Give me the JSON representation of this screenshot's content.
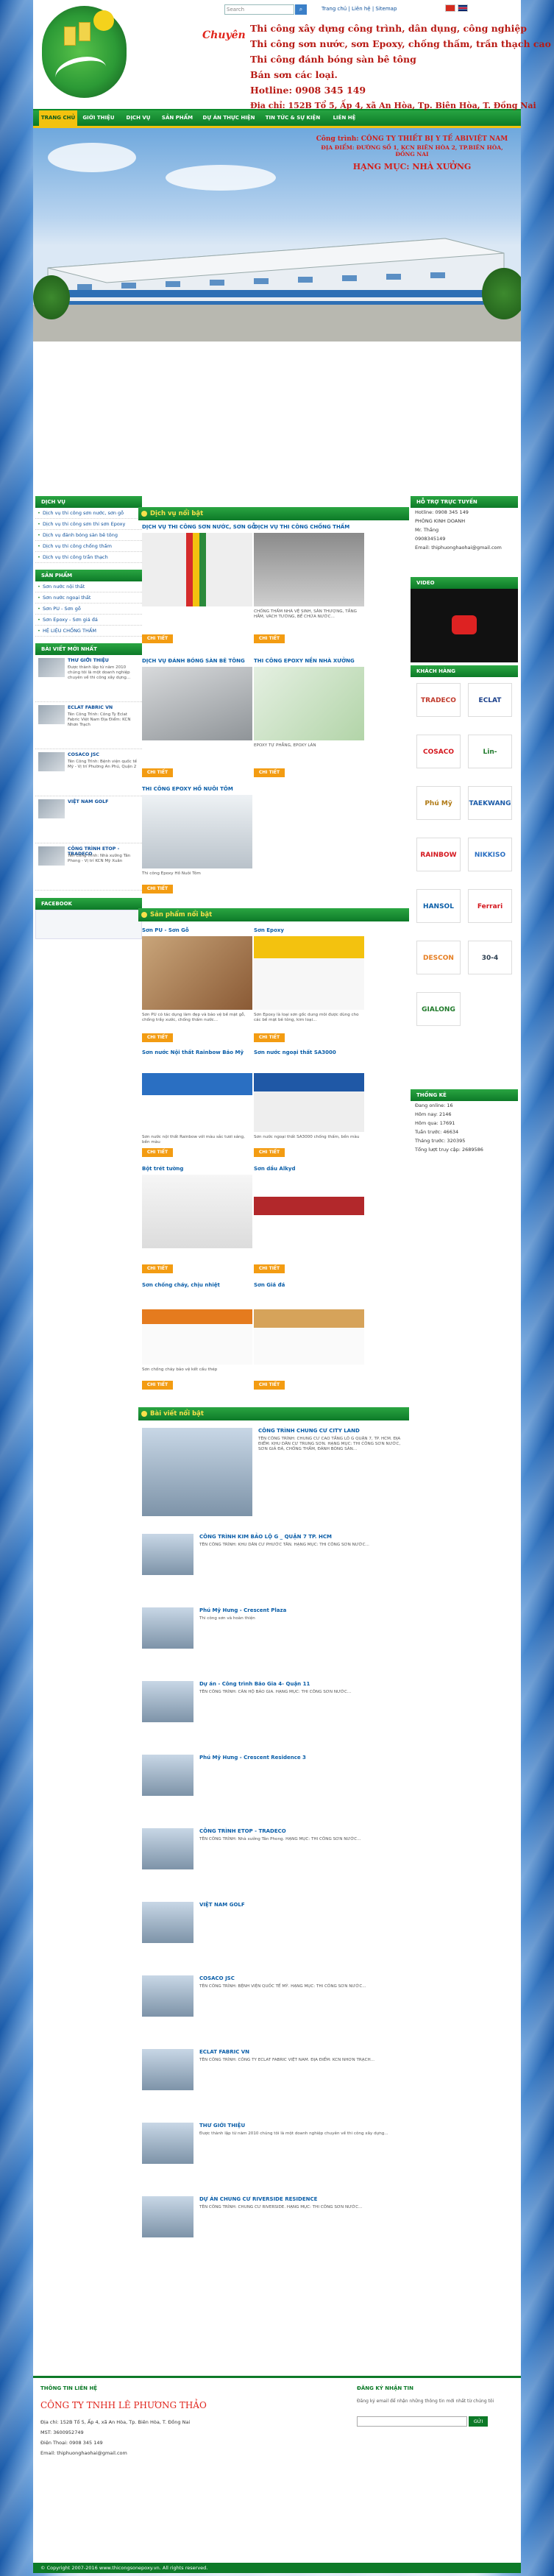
{
  "header": {
    "logo_script": "Chuyên",
    "search_placeholder": "Search",
    "toplinks": "Trang chủ | Liên hệ | Sitemap",
    "lines": [
      "Thi công xây dựng công trình, dân dụng, công nghiệp",
      "Thi công sơn nước, sơn Epoxy, chống thấm, trần thạch cao",
      "Thi công đánh bóng sàn bê tông",
      "Bán sơn các loại.",
      "Hotline: 0908 345 149",
      "Địa chỉ: 152B Tổ 5, Ấp 4, xã An Hòa, Tp. Biên Hòa, T. Đồng Nai"
    ]
  },
  "nav": [
    "TRANG CHỦ",
    "GIỚI THIỆU",
    "DỊCH VỤ",
    "SẢN PHẨM",
    "DỰ ÁN THỰC HIỆN",
    "TIN TỨC & SỰ KIỆN",
    "LIÊN HỆ"
  ],
  "banner": {
    "t1": "Công trình: CÔNG TY THIẾT BỊ Y TẾ ABIVIỆT NAM",
    "t2": "ĐỊA ĐIỂM: ĐƯỜNG SỐ 1, KCN BIÊN HÒA 2, TP.BIÊN HÒA, ĐỒNG NAI",
    "t3": "HẠNG MỤC: NHÀ XƯỞNG"
  },
  "left": {
    "dichvu_head": "DỊCH VỤ",
    "dichvu": [
      "Dịch vụ thi công sơn nước, sơn gỗ",
      "Dịch vụ thi công sơn thi sơn Epoxy",
      "Dịch vụ đánh bóng sàn bê tông",
      "Dịch vụ thi công chống thấm",
      "Dịch vụ thi công trần thạch"
    ],
    "sanpham_head": "SẢN PHẨM",
    "sanpham": [
      "Sơn nước nội thất",
      "Sơn nước ngoại thất",
      "Sơn PU - Sơn gỗ",
      "Sơn Epoxy - Sơn giả đá",
      "HỆ LIỆU CHỐNG THẤM"
    ],
    "news_head": "BÀI VIẾT MỚI NHẤT",
    "news": [
      {
        "title": "THƯ GIỚI THIỆU",
        "desc": "Được thành lập từ năm 2010 chúng tôi là một doanh nghiệp chuyên về thi công xây dựng..."
      },
      {
        "title": "ECLAT FABRIC VN",
        "desc": "Tên Công Trình: Công Ty Eclat Fabric Việt Nam Địa Điểm: KCN Nhơn Trạch"
      },
      {
        "title": "COSACO JSC",
        "desc": "Tên Công Trình: Bệnh viện quốc tế Mỹ - Vị trí Phường An Phú, Quận 2"
      },
      {
        "title": "VIỆT NAM GOLF",
        "desc": ""
      },
      {
        "title": "CÔNG TRÌNH ETOP - TRADECO",
        "desc": "Tên Công Trình: Nhà xưởng Tân Phong - Vị trí KCN Mỹ Xuân"
      }
    ],
    "facebook_head": "FACEBOOK"
  },
  "right": {
    "support_head": "HỖ TRỢ TRỰC TUYẾN",
    "support": [
      "Hotline: 0908 345 149",
      "PHÒNG KINH DOANH",
      "Mr. Thắng",
      "0908345149",
      "Email: thiphuonghaohai@gmail.com"
    ],
    "video_head": "VIDEO",
    "partners_head": "KHÁCH HÀNG",
    "partners": [
      "TRADECO",
      "ECLAT",
      "COSACO",
      "Lin-Precision",
      "Phú Mỹ Hưng",
      "TAEKWANG",
      "RAINBOW",
      "NIKKISO",
      "HANSOL",
      "Ferrari",
      "DESCON",
      "30-4",
      "GIALONG"
    ],
    "stats_head": "THỐNG KÊ",
    "stats": [
      "Đang online: 16",
      "Hôm nay: 2146",
      "Hôm qua: 17691",
      "Tuần trước: 46634",
      "Tháng trước: 320395",
      "Tổng lượt truy cập: 2689586"
    ]
  },
  "services": {
    "head": "Dịch vụ nổi bật",
    "items": [
      {
        "title": "DỊCH VỤ THI CÔNG SƠN NƯỚC, SƠN GỖ",
        "desc": ""
      },
      {
        "title": "DỊCH VỤ THI CÔNG CHỐNG THẤM",
        "desc": "CHỐNG THẤM NHÀ VỆ SINH, SÂN THƯỢNG, TẦNG HẦM, VÁCH TƯỜNG, BỂ CHỨA NƯỚC..."
      },
      {
        "title": "DỊCH VỤ ĐÁNH BÓNG SÀN BÊ TÔNG",
        "desc": ""
      },
      {
        "title": "THI CÔNG EPOXY NỀN NHÀ XƯỞNG",
        "desc": "EPOXY TỰ PHẲNG, EPOXY LĂN"
      },
      {
        "title": "THI CÔNG EPOXY HỒ NUÔI TÔM",
        "desc": "Thi công Epoxy Hồ Nuôi Tôm"
      }
    ],
    "more": "CHI TIẾT"
  },
  "products": {
    "head": "Sản phẩm nổi bật",
    "items": [
      {
        "title": "Sơn PU - Sơn Gỗ",
        "desc": "Sơn PU có tác dụng làm đẹp và bảo vệ bề mặt gỗ, chống trầy xước, chống thấm nước..."
      },
      {
        "title": "Sơn Epoxy",
        "desc": "Sơn Epoxy là loại sơn gốc dung môi được dùng cho các bề mặt bê tông, kim loại..."
      },
      {
        "title": "Sơn nước Nội thất Rainbow Bảo Mỹ",
        "desc": "Sơn nước nội thất Rainbow với màu sắc tươi sáng, bền màu"
      },
      {
        "title": "Sơn nước ngoại thất SA3000",
        "desc": "Sơn nước ngoại thất SA3000 chống thấm, bền màu"
      },
      {
        "title": "Bột trét tường",
        "desc": ""
      },
      {
        "title": "Sơn dầu Alkyd",
        "desc": ""
      },
      {
        "title": "Sơn chống cháy, chịu nhiệt",
        "desc": "Sơn chống cháy bảo vệ kết cấu thép"
      },
      {
        "title": "Sơn Giả đá",
        "desc": ""
      }
    ],
    "more": "CHI TIẾT"
  },
  "articles": {
    "head": "Bài viết nổi bật",
    "top": {
      "title": "CÔNG TRÌNH CHUNG CƯ CITY LAND",
      "desc": "TÊN CÔNG TRÌNH: CHUNG CƯ CAO TẦNG LÔ G QUẬN 7, TP. HCM. ĐỊA ĐIỂM: KHU DÂN CƯ TRUNG SƠN. HẠNG MỤC: THI CÔNG SƠN NƯỚC, SƠN GIẢ ĐÁ, CHỐNG THẤM, ĐÁNH BÓNG SÀN..."
    },
    "items": [
      {
        "title": "CÔNG TRÌNH KIM BẢO LỘ G _ QUẬN 7 TP. HCM",
        "desc": "TÊN CÔNG TRÌNH: KHU DÂN CƯ PHƯỚC TÂN. HẠNG MỤC: THI CÔNG SƠN NƯỚC..."
      },
      {
        "title": "Phú Mỹ Hưng - Crescent Plaza",
        "desc": "Thi công sơn và hoàn thiện"
      },
      {
        "title": "Dự án - Công trình Bảo Gia 4- Quận 11",
        "desc": "TÊN CÔNG TRÌNH: CĂN HỘ BẢO GIA. HẠNG MỤC: THI CÔNG SƠN NƯỚC..."
      },
      {
        "title": "Phú Mỹ Hưng - Crescent Residence 3",
        "desc": ""
      },
      {
        "title": "CÔNG TRÌNH ETOP - TRADECO",
        "desc": "TÊN CÔNG TRÌNH: Nhà xưởng Tân Phong. HẠNG MỤC: THI CÔNG SƠN NƯỚC..."
      },
      {
        "title": "VIỆT NAM GOLF",
        "desc": ""
      },
      {
        "title": "COSACO JSC",
        "desc": "TÊN CÔNG TRÌNH: BỆNH VIỆN QUỐC TẾ MỸ. HẠNG MỤC: THI CÔNG SƠN NƯỚC..."
      },
      {
        "title": "ECLAT FABRIC VN",
        "desc": "TÊN CÔNG TRÌNH: CÔNG TY ECLAT FABRIC VIỆT NAM. ĐỊA ĐIỂM: KCN NHƠN TRẠCH..."
      },
      {
        "title": "THƯ GIỚI THIỆU",
        "desc": "Được thành lập từ năm 2010 chúng tôi là một doanh nghiệp chuyên về thi công xây dựng..."
      },
      {
        "title": "DỰ ÁN CHUNG CƯ RIVERSIDE RESIDENCE",
        "desc": "TÊN CÔNG TRÌNH: CHUNG CƯ RIVERSIDE. HẠNG MỤC: THI CÔNG SƠN NƯỚC..."
      }
    ]
  },
  "footer": {
    "contact_head": "THÔNG TIN LIÊN HỆ",
    "company": "CÔNG TY TNHH LÊ PHƯƠNG THẢO",
    "lines": [
      "Địa chỉ: 152B Tổ 5, Ấp 4, xã An Hòa, Tp. Biên Hòa, T. Đồng Nai",
      "MST: 3600952749",
      "Điện Thoại: 0908 345 149",
      "Email: thiphuonghaohai@gmail.com"
    ],
    "sub_head": "ĐĂNG KÝ NHẬN TIN",
    "sub_desc": "Đăng ký email để nhận những thông tin mới nhất từ chúng tôi",
    "sub_btn": "GỬI",
    "copyright": "© Copyright 2007-2016 www.thicongsonepoxy.vn. All rights reserved."
  },
  "colors": {
    "green": "#0d7a28",
    "yellow": "#f3c20f",
    "red": "#e0241b",
    "blue": "#0b5ea8"
  }
}
